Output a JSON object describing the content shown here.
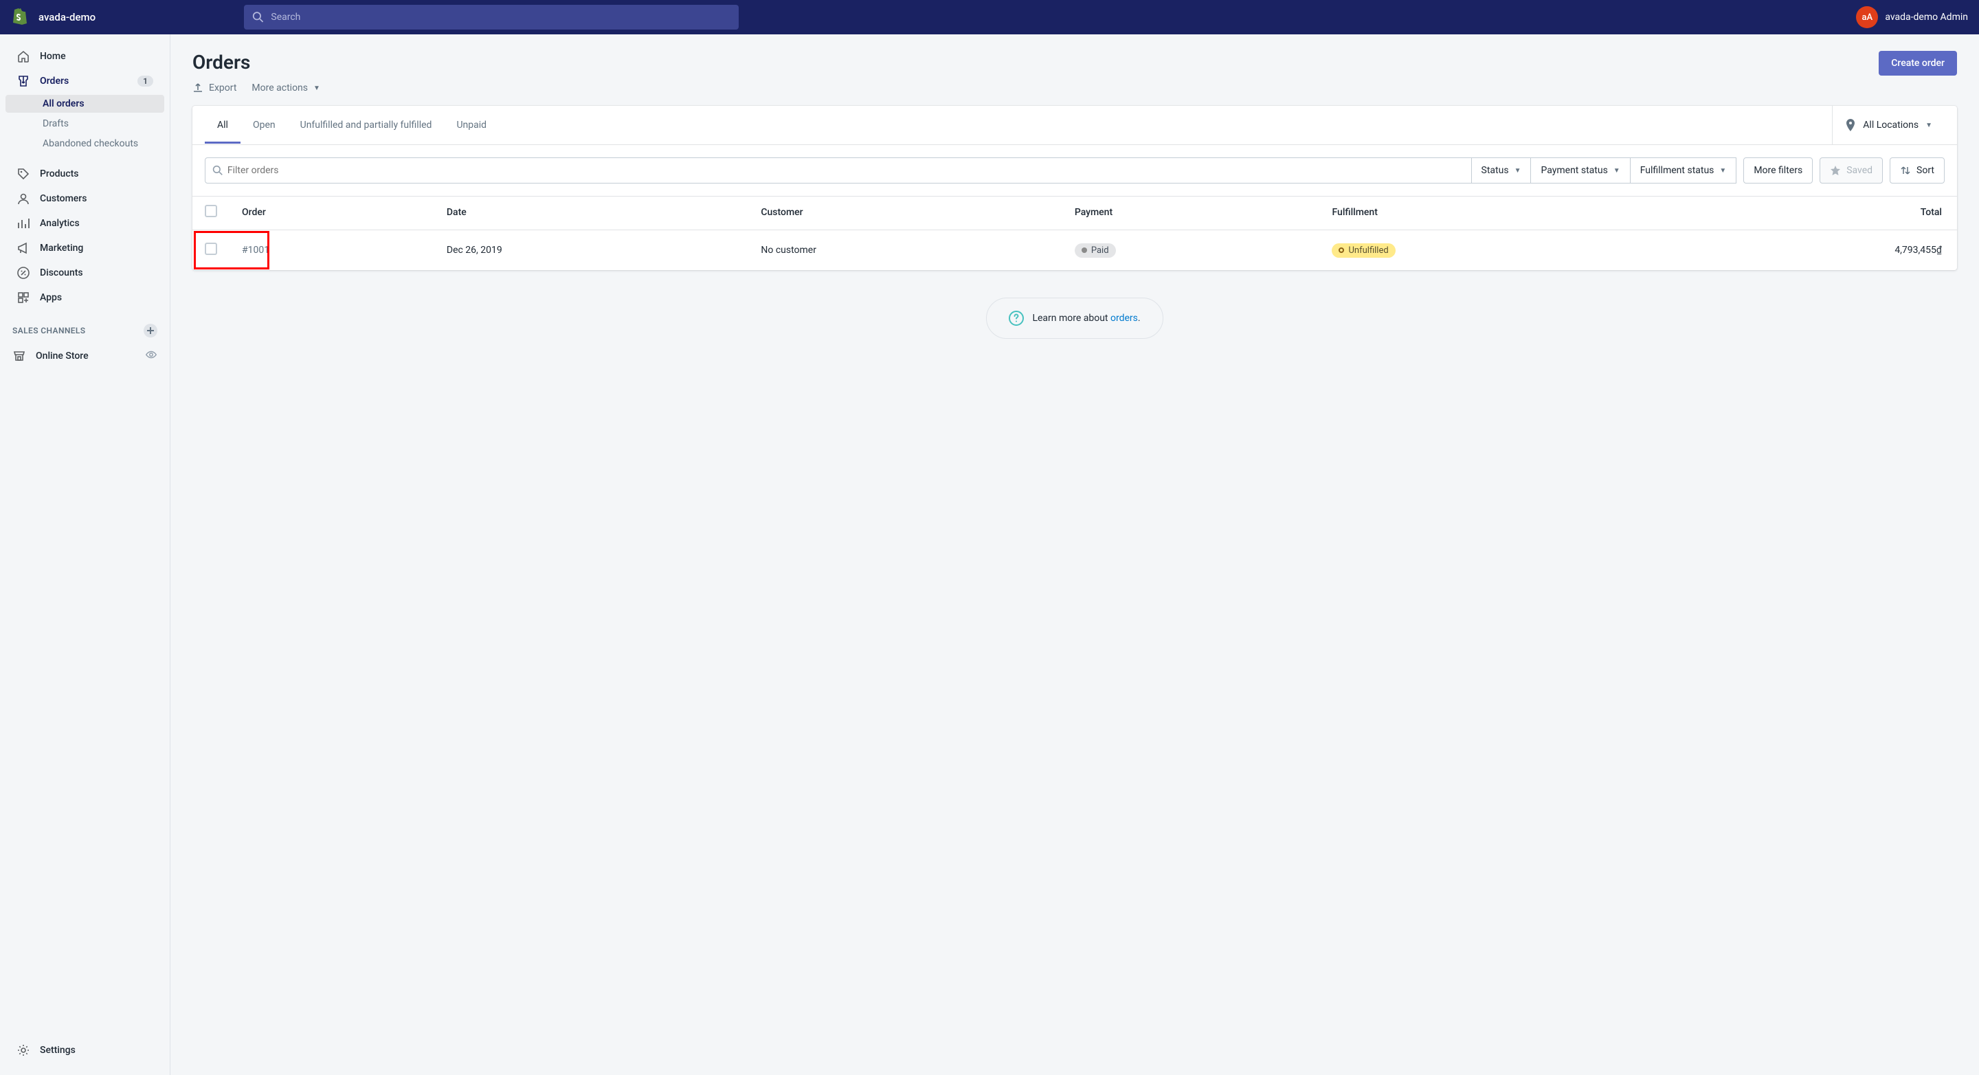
{
  "topbar": {
    "shop_name": "avada-demo",
    "search_placeholder": "Search",
    "avatar_initials": "aA",
    "user_name": "avada-demo Admin"
  },
  "sidebar": {
    "items": [
      {
        "id": "home",
        "label": "Home",
        "icon": "home-icon",
        "badge": null,
        "selected": false,
        "sub": []
      },
      {
        "id": "orders",
        "label": "Orders",
        "icon": "orders-icon",
        "badge": "1",
        "selected": true,
        "sub": [
          {
            "label": "All orders",
            "active": true
          },
          {
            "label": "Drafts",
            "active": false
          },
          {
            "label": "Abandoned checkouts",
            "active": false
          }
        ]
      },
      {
        "id": "products",
        "label": "Products",
        "icon": "products-icon",
        "badge": null,
        "selected": false,
        "sub": []
      },
      {
        "id": "customers",
        "label": "Customers",
        "icon": "customers-icon",
        "badge": null,
        "selected": false,
        "sub": []
      },
      {
        "id": "analytics",
        "label": "Analytics",
        "icon": "analytics-icon",
        "badge": null,
        "selected": false,
        "sub": []
      },
      {
        "id": "marketing",
        "label": "Marketing",
        "icon": "marketing-icon",
        "badge": null,
        "selected": false,
        "sub": []
      },
      {
        "id": "discounts",
        "label": "Discounts",
        "icon": "discounts-icon",
        "badge": null,
        "selected": false,
        "sub": []
      },
      {
        "id": "apps",
        "label": "Apps",
        "icon": "apps-icon",
        "badge": null,
        "selected": false,
        "sub": []
      }
    ],
    "section_title": "SALES CHANNELS",
    "channels": [
      {
        "label": "Online Store",
        "icon": "onlinestore-icon"
      }
    ],
    "settings_label": "Settings"
  },
  "page": {
    "title": "Orders",
    "create_button": "Create order",
    "export_label": "Export",
    "more_actions_label": "More actions"
  },
  "tabs": [
    {
      "label": "All",
      "active": true
    },
    {
      "label": "Open",
      "active": false
    },
    {
      "label": "Unfulfilled and partially fulfilled",
      "active": false
    },
    {
      "label": "Unpaid",
      "active": false
    }
  ],
  "location": {
    "label": "All Locations"
  },
  "filters": {
    "search_placeholder": "Filter orders",
    "status": "Status",
    "payment_status": "Payment status",
    "fulfillment_status": "Fulfillment status",
    "more_filters": "More filters",
    "saved": "Saved",
    "sort": "Sort"
  },
  "table": {
    "columns": [
      "Order",
      "Date",
      "Customer",
      "Payment",
      "Fulfillment",
      "Total"
    ],
    "rows": [
      {
        "order": "#1001",
        "date": "Dec 26, 2019",
        "customer": "No customer",
        "payment": "Paid",
        "fulfillment": "Unfulfilled",
        "total": "4,793,455₫"
      }
    ]
  },
  "learn": {
    "prefix": "Learn more about ",
    "link": "orders",
    "suffix": "."
  }
}
